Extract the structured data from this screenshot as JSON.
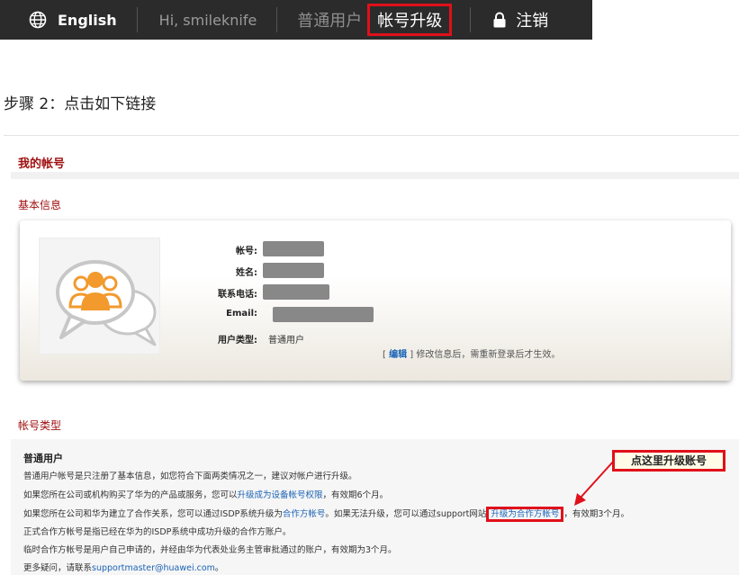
{
  "topbar": {
    "language": "English",
    "greeting": "Hi, smileknife",
    "role": "普通用户",
    "upgrade": "帐号升级",
    "logout": "注销"
  },
  "step_title": "步骤 2：点击如下链接",
  "account": {
    "section_title": "我的帐号",
    "basic_info_title": "基本信息",
    "fields": {
      "account_label": "帐号:",
      "name_label": "姓名:",
      "phone_label": "联系电话:",
      "email_label": "Email:",
      "user_type_label": "用户类型:",
      "user_type_value": "普通用户"
    },
    "edit_prefix": "[",
    "edit_link": "编辑",
    "edit_suffix": "] 修改信息后，需重新登录后才生效。"
  },
  "account_type": {
    "title": "帐号类型",
    "heading": "普通用户",
    "line1": "普通用户帐号是只注册了基本信息，如您符合下面两类情况之一，建议对帐户进行升级。",
    "line2_a": "如果您所在公司或机构购买了华为的产品或服务，您可以",
    "line2_link": "升级成为设备帐号权限",
    "line2_b": "，有效期6个月。",
    "line3_a": "如果您所在公司和华为建立了合作关系，您可以通过ISDP系统升级为",
    "line3_link1": "合作方帐号",
    "line3_b": "。如果无法升级，您可以通过support网站",
    "line3_link2": "升级为合作方帐号",
    "line3_c": "，有效期3个月。",
    "line4": "正式合作方帐号是指已经在华为的ISDP系统中成功升级的合作方账户。",
    "line5": "临时合作方帐号是用户自己申请的，并经由华为代表处业务主管审批通过的账户，有效期为3个月。",
    "line6_a": "更多疑问，请联系",
    "line6_link": "supportmaster@huawei.com",
    "line6_b": "。"
  },
  "callout": "点这里升级账号",
  "colors": {
    "accent_red": "#e0101a",
    "link_blue": "#1a63b5",
    "title_red": "#a01010",
    "nav_bg": "#2b2b2b"
  }
}
